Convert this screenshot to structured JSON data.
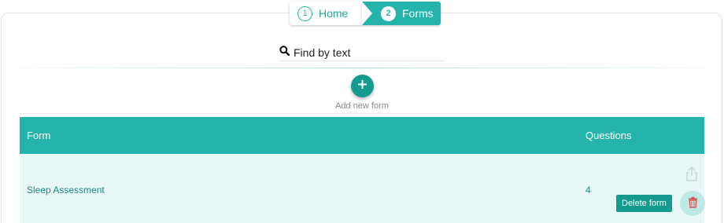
{
  "breadcrumb": {
    "steps": [
      {
        "number": "1",
        "label": "Home"
      },
      {
        "number": "2",
        "label": "Forms"
      }
    ]
  },
  "search": {
    "placeholder": "Find by text",
    "value": ""
  },
  "add_form": {
    "label": "Add new form"
  },
  "table": {
    "headers": {
      "form": "Form",
      "questions": "Questions"
    },
    "rows": [
      {
        "form": "Sleep Assessment",
        "questions": "4",
        "delete_label": "Delete form"
      }
    ]
  },
  "colors": {
    "accent": "#24b4ac",
    "accent_dark": "#159a8f",
    "row_bg": "#e6f7f5"
  },
  "icons": [
    "search-icon",
    "plus-icon",
    "share-icon",
    "trash-icon"
  ]
}
